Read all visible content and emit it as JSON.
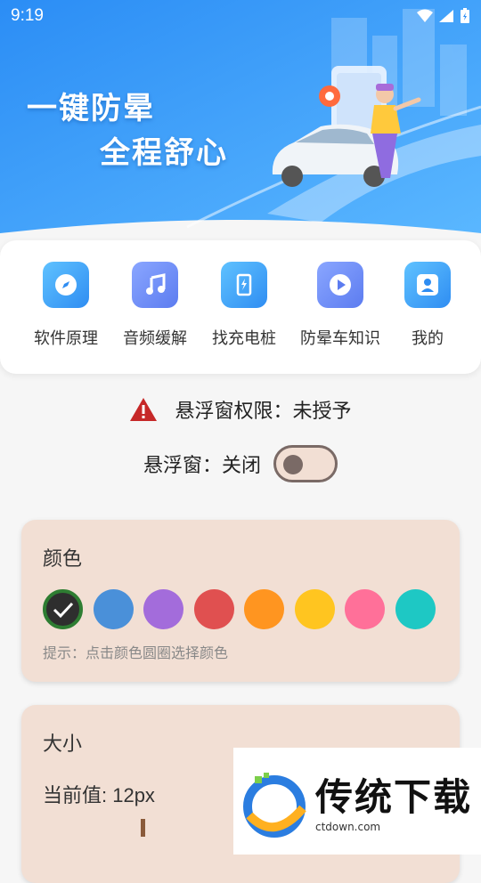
{
  "status_bar": {
    "time": "9:19"
  },
  "banner": {
    "slogan_line1": "一键防晕",
    "slogan_line2": "全程舒心"
  },
  "nav": {
    "items": [
      {
        "label": "软件原理",
        "icon": "compass-icon",
        "color": "#42a5f5"
      },
      {
        "label": "音频缓解",
        "icon": "music-note-icon",
        "color": "#6c8cf5"
      },
      {
        "label": "找充电桩",
        "icon": "charging-station-icon",
        "color": "#3fa6f3"
      },
      {
        "label": "防晕车知识",
        "icon": "play-icon",
        "color": "#6c8cf5"
      },
      {
        "label": "我的",
        "icon": "user-icon",
        "color": "#42a5f5"
      }
    ]
  },
  "permission": {
    "text": "悬浮窗权限：未授予",
    "icon": "warning-icon"
  },
  "float_window": {
    "label": "悬浮窗：关闭",
    "enabled": false
  },
  "color_panel": {
    "title": "颜色",
    "selected_index": 0,
    "colors": [
      "#2e7d32",
      "#4a90d9",
      "#a36cdb",
      "#e05050",
      "#ff9520",
      "#ffc520",
      "#ff7099",
      "#1ec8c4"
    ],
    "hint": "提示：点击颜色圆圈选择颜色"
  },
  "size_panel": {
    "title": "大小",
    "current_value": "当前值: 12px"
  },
  "watermark": {
    "brand": "传统下载",
    "domain": "ctdown.com"
  }
}
